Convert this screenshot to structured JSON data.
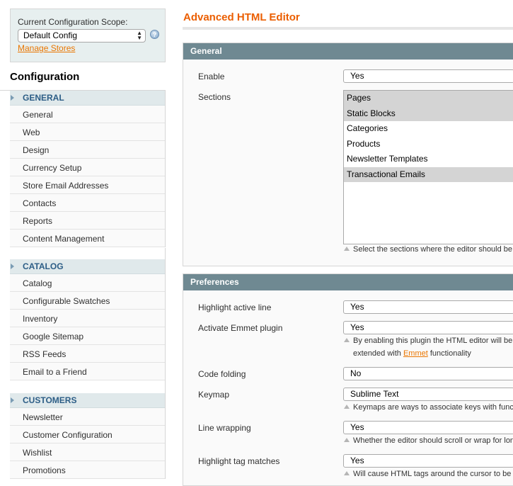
{
  "scope": {
    "label": "Current Configuration Scope:",
    "selected": "Default Config",
    "help": "?",
    "manage_link": "Manage Stores"
  },
  "sidebar": {
    "title": "Configuration",
    "groups": [
      {
        "heading": "GENERAL",
        "items": [
          "General",
          "Web",
          "Design",
          "Currency Setup",
          "Store Email Addresses",
          "Contacts",
          "Reports",
          "Content Management"
        ]
      },
      {
        "heading": "CATALOG",
        "items": [
          "Catalog",
          "Configurable Swatches",
          "Inventory",
          "Google Sitemap",
          "RSS Feeds",
          "Email to a Friend"
        ]
      },
      {
        "heading": "CUSTOMERS",
        "items": [
          "Newsletter",
          "Customer Configuration",
          "Wishlist",
          "Promotions"
        ]
      }
    ]
  },
  "main": {
    "title": "Advanced HTML Editor",
    "general": {
      "heading": "General",
      "enable_label": "Enable",
      "enable_value": "Yes",
      "sections_label": "Sections",
      "sections_options": [
        {
          "label": "Pages",
          "selected": true
        },
        {
          "label": "Static Blocks",
          "selected": true
        },
        {
          "label": "Categories",
          "selected": false
        },
        {
          "label": "Products",
          "selected": false
        },
        {
          "label": "Newsletter Templates",
          "selected": false
        },
        {
          "label": "Transactional Emails",
          "selected": true
        }
      ],
      "sections_note": "Select the sections where the editor should be"
    },
    "preferences": {
      "heading": "Preferences",
      "highlight_label": "Highlight active line",
      "highlight_value": "Yes",
      "emmet_label": "Activate Emmet plugin",
      "emmet_value": "Yes",
      "emmet_note_1": "By enabling this plugin the HTML editor will be",
      "emmet_note_2a": "extended with ",
      "emmet_note_link": "Emmet",
      "emmet_note_2b": " functionality",
      "folding_label": "Code folding",
      "folding_value": "No",
      "keymap_label": "Keymap",
      "keymap_value": "Sublime Text",
      "keymap_note": "Keymaps are ways to associate keys with func",
      "wrap_label": "Line wrapping",
      "wrap_value": "Yes",
      "wrap_note": "Whether the editor should scroll or wrap for lon",
      "tags_label": "Highlight tag matches",
      "tags_value": "Yes",
      "tags_note": "Will cause HTML tags around the cursor to be"
    }
  }
}
